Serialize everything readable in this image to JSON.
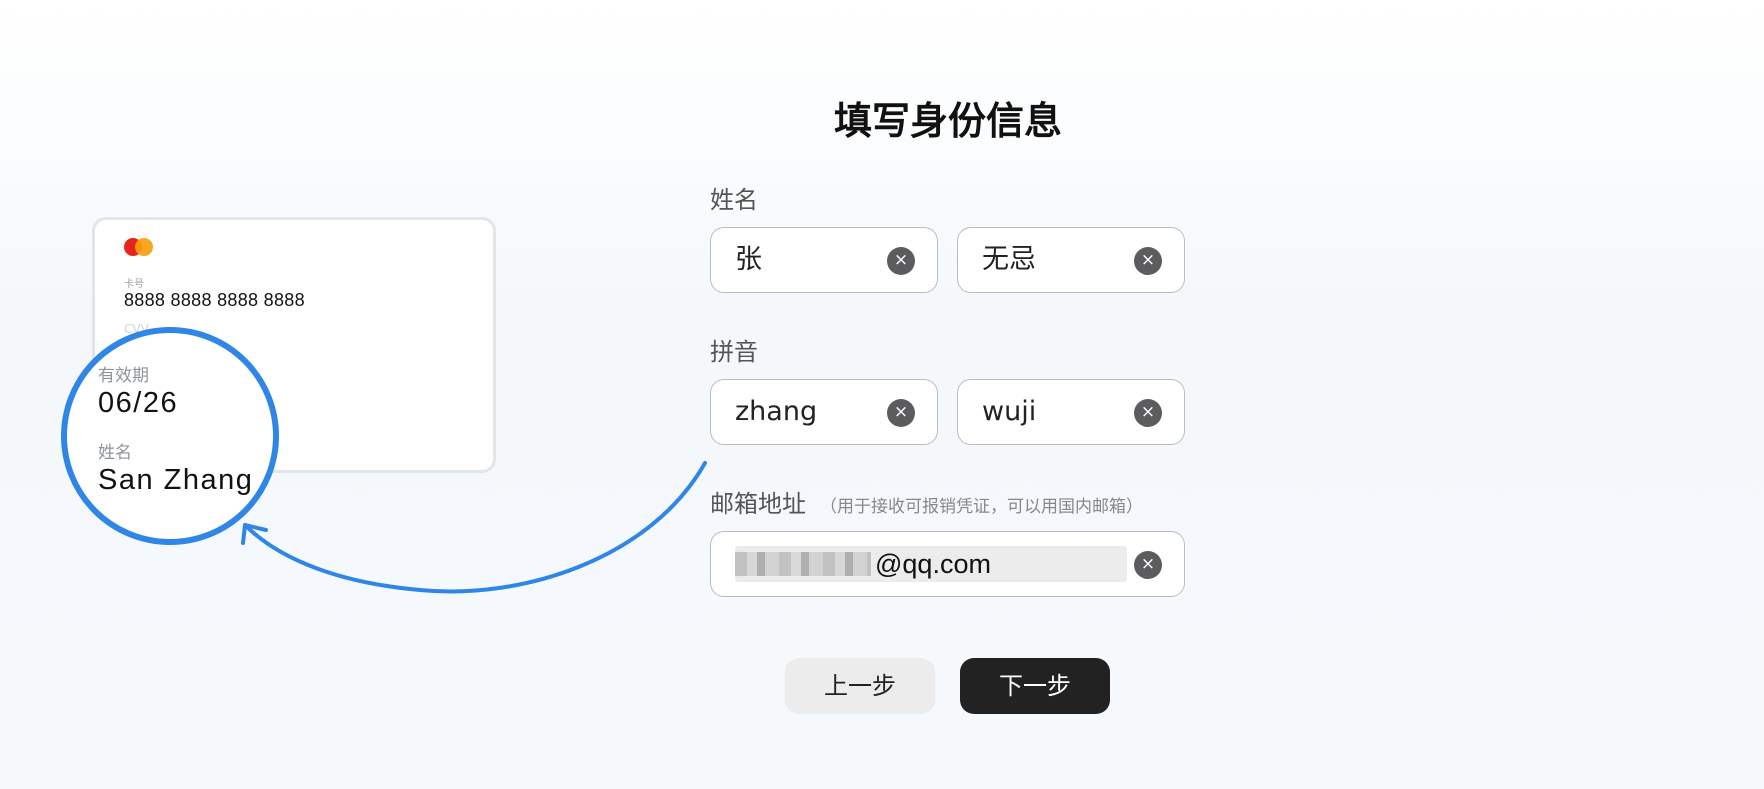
{
  "page": {
    "title": "填写身份信息"
  },
  "card": {
    "number_label": "卡号",
    "number": "8888 8888 8888 8888",
    "cvv_label": "CVV",
    "expiry_label": "有效期",
    "expiry": "06/26",
    "name_label": "姓名",
    "name": "San Zhang"
  },
  "form": {
    "name": {
      "label": "姓名",
      "surname": "张",
      "given": "无忌"
    },
    "pinyin": {
      "label": "拼音",
      "surname": "zhang",
      "given": "wuji"
    },
    "email": {
      "label": "邮箱地址",
      "hint": "（用于接收可报销凭证，可以用国内邮箱）",
      "value_suffix": "@qq.com"
    }
  },
  "actions": {
    "prev_label": "上一步",
    "next_label": "下一步"
  },
  "colors": {
    "accent_blue": "#2f86e6",
    "primary_button": "#222222",
    "secondary_button": "#ececec"
  },
  "icons": {
    "clear": "×"
  }
}
